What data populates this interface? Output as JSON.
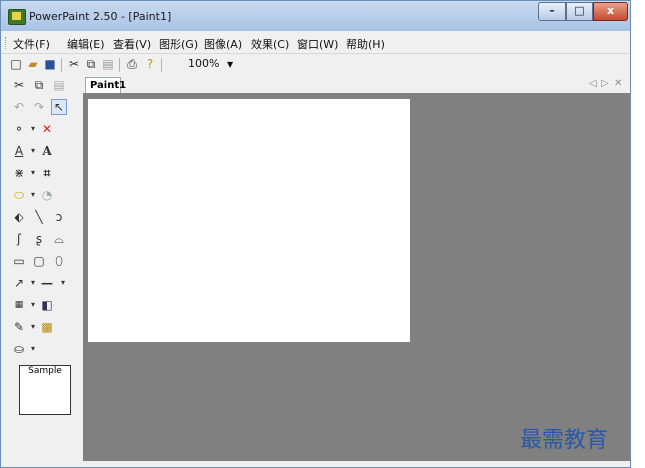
{
  "window": {
    "title": "PowerPaint 2.50 - [Paint1]",
    "controls": {
      "minimize": "–",
      "maximize": "□",
      "close": "x"
    }
  },
  "menu": {
    "items": [
      "文件(F)",
      "编辑(E)",
      "查看(V)",
      "图形(G)",
      "图像(A)",
      "效果(C)",
      "窗口(W)",
      "帮助(H)"
    ]
  },
  "toolbar": {
    "zoom_value": "100%"
  },
  "sidebar": {
    "sample_label": "Sample"
  },
  "document": {
    "tab_label": "Paint1",
    "tab_nav": {
      "prev": "◁",
      "next": "▷",
      "close": "✕"
    }
  },
  "watermark": {
    "text": "最需教育"
  },
  "colors": {
    "canvas_background": "#808080",
    "paper": "#ffffff",
    "title_bar": "#b4cbe9",
    "close_button": "#c64a2f"
  }
}
